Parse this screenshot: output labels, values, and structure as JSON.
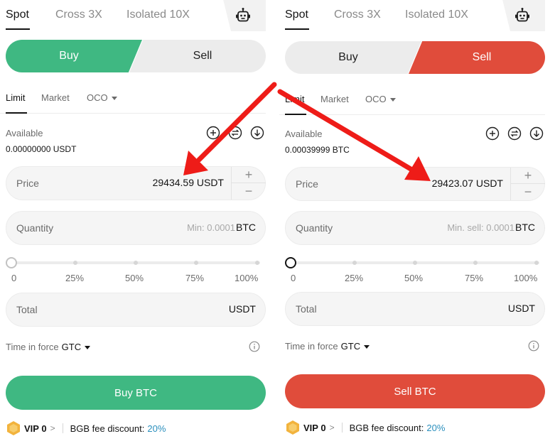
{
  "colors": {
    "buy": "#3fb882",
    "sell": "#e04c3b",
    "arrow": "#ee1c18",
    "link": "#2a8fbd"
  },
  "left": {
    "tabs": [
      "Spot",
      "Cross 3X",
      "Isolated 10X"
    ],
    "buy_label": "Buy",
    "sell_label": "Sell",
    "active_side": "buy",
    "order_tabs": [
      "Limit",
      "Market",
      "OCO"
    ],
    "available_label": "Available",
    "available_value": "0.00000000 USDT",
    "price_label": "Price",
    "price_value": "29434.59",
    "price_unit": "USDT",
    "quantity_label": "Quantity",
    "quantity_placeholder": "Min: 0.0001",
    "quantity_unit": "BTC",
    "slider_marks": [
      "0",
      "25%",
      "50%",
      "75%",
      "100%"
    ],
    "slider_value": 0,
    "total_label": "Total",
    "total_unit": "USDT",
    "tif_label": "Time in force",
    "tif_value": "GTC",
    "action_label": "Buy BTC",
    "vip_label": "VIP 0",
    "fee_label": "BGB fee discount:",
    "fee_value": "20%"
  },
  "right": {
    "tabs": [
      "Spot",
      "Cross 3X",
      "Isolated 10X"
    ],
    "buy_label": "Buy",
    "sell_label": "Sell",
    "active_side": "sell",
    "order_tabs": [
      "Limit",
      "Market",
      "OCO"
    ],
    "available_label": "Available",
    "available_value": "0.00039999 BTC",
    "price_label": "Price",
    "price_value": "29423.07",
    "price_unit": "USDT",
    "quantity_label": "Quantity",
    "quantity_placeholder": "Min. sell: 0.0001",
    "quantity_unit": "BTC",
    "slider_marks": [
      "0",
      "25%",
      "50%",
      "75%",
      "100%"
    ],
    "slider_value": 0,
    "total_label": "Total",
    "total_unit": "USDT",
    "tif_label": "Time in force",
    "tif_value": "GTC",
    "action_label": "Sell BTC",
    "vip_label": "VIP 0",
    "fee_label": "BGB fee discount:",
    "fee_value": "20%"
  }
}
